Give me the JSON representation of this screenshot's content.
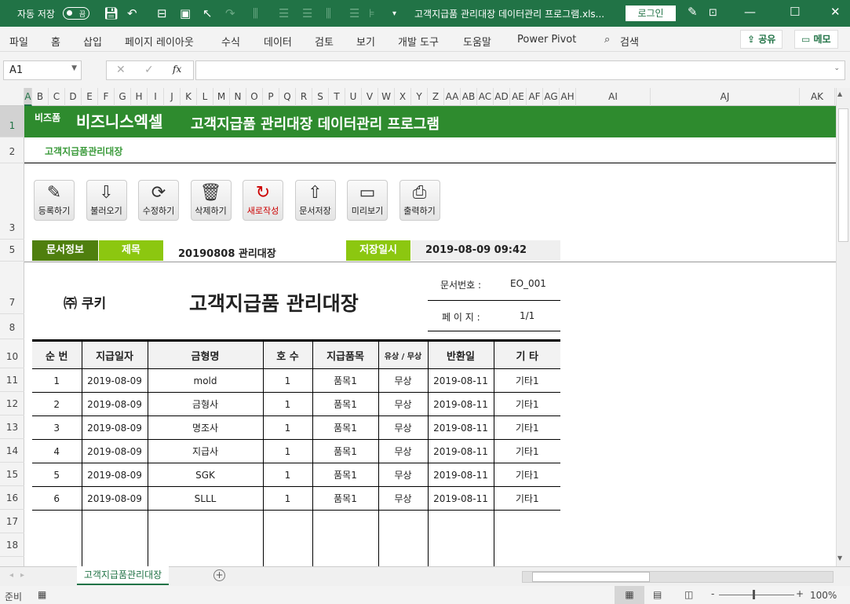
{
  "titlebar": {
    "autosave_label": "자동 저장",
    "autosave_state": "끔",
    "title": "고객지급품 관리대장 데이터관리 프로그램.xls...",
    "login": "로그인",
    "minimize": "—",
    "maximize": "☐",
    "close": "✕"
  },
  "menu": {
    "items": [
      "파일",
      "홈",
      "삽입",
      "페이지 레이아웃",
      "수식",
      "데이터",
      "검토",
      "보기",
      "개발 도구",
      "도움말",
      "Power Pivot"
    ],
    "search": "검색",
    "share": "공유",
    "memo": "메모"
  },
  "formula": {
    "name_box": "A1",
    "cancel": "✕",
    "enter": "✓",
    "fx": "fx",
    "value": ""
  },
  "columns": [
    "A",
    "B",
    "C",
    "D",
    "E",
    "F",
    "G",
    "H",
    "I",
    "J",
    "K",
    "L",
    "M",
    "N",
    "O",
    "P",
    "Q",
    "R",
    "S",
    "T",
    "U",
    "V",
    "W",
    "X",
    "Y",
    "Z",
    "AA",
    "AB",
    "AC",
    "AD",
    "AE",
    "AF",
    "AG",
    "AH",
    "AI",
    "AJ",
    "AK"
  ],
  "rows": [
    "1",
    "2",
    "3",
    "5",
    "7",
    "8",
    "10",
    "11",
    "12",
    "13",
    "14",
    "15",
    "16",
    "17",
    "18"
  ],
  "sheet": {
    "brand_small": "비즈폼",
    "brand": "비즈니스엑셀",
    "banner_title": "고객지급품 관리대장 데이터관리 프로그램",
    "subtitle": "고객지급품관리대장",
    "tools": [
      {
        "label": "등록하기",
        "icon": "pencil-icon",
        "glyph": "✎"
      },
      {
        "label": "불러오기",
        "icon": "folder-download-icon",
        "glyph": "⇩"
      },
      {
        "label": "수정하기",
        "icon": "refresh-icon",
        "glyph": "⟳"
      },
      {
        "label": "삭제하기",
        "icon": "trash-icon",
        "glyph": "🗑"
      },
      {
        "label": "새로작성",
        "icon": "new-icon",
        "glyph": "↻"
      },
      {
        "label": "문서저장",
        "icon": "folder-upload-icon",
        "glyph": "⇧"
      },
      {
        "label": "미리보기",
        "icon": "monitor-icon",
        "glyph": "▭"
      },
      {
        "label": "출력하기",
        "icon": "printer-icon",
        "glyph": "⎙"
      }
    ],
    "info": {
      "doc_info": "문서정보",
      "title_label": "제목",
      "title_value": "20190808 관리대장",
      "saved_label": "저장일시",
      "saved_value": "2019-08-09 09:42"
    },
    "company": "㈜ 쿠키",
    "doc_title": "고객지급품 관리대장",
    "doc_no_label": "문서번호 :",
    "doc_no": "EO_001",
    "page_label": "페 이 지 :",
    "page": "1/1",
    "table": {
      "headers": [
        "순 번",
        "지급일자",
        "금형명",
        "호 수",
        "지급품목",
        "유상 / 무상",
        "반환일",
        "기 타"
      ],
      "rows": [
        [
          "1",
          "2019-08-09",
          "mold",
          "1",
          "품목1",
          "무상",
          "2019-08-11",
          "기타1"
        ],
        [
          "2",
          "2019-08-09",
          "금형사",
          "1",
          "품목1",
          "무상",
          "2019-08-11",
          "기타1"
        ],
        [
          "3",
          "2019-08-09",
          "명조사",
          "1",
          "품목1",
          "무상",
          "2019-08-11",
          "기타1"
        ],
        [
          "4",
          "2019-08-09",
          "지급사",
          "1",
          "품목1",
          "무상",
          "2019-08-11",
          "기타1"
        ],
        [
          "5",
          "2019-08-09",
          "SGK",
          "1",
          "품목1",
          "무상",
          "2019-08-11",
          "기타1"
        ],
        [
          "6",
          "2019-08-09",
          "SLLL",
          "1",
          "품목1",
          "무상",
          "2019-08-11",
          "기타1"
        ]
      ]
    }
  },
  "tabs": {
    "active": "고객지급품관리대장",
    "add": "+"
  },
  "status": {
    "ready": "준비",
    "zoom": "100%"
  }
}
